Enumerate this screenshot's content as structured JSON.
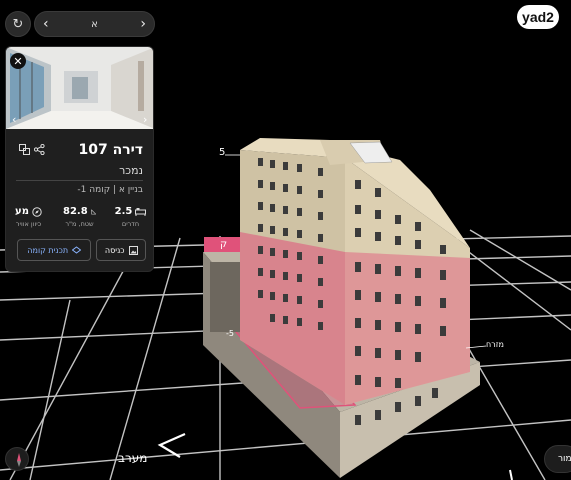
{
  "topbar": {
    "building_label": "א"
  },
  "logo": {
    "text": "yad2"
  },
  "card": {
    "title": "דירה 107",
    "status": "נמכר",
    "location": "בניין א  |  קומה 1-",
    "specs": [
      {
        "value": "2.5",
        "label": "חדרים",
        "icon": "bed-icon"
      },
      {
        "value": "82.8",
        "label": "שטח, מ\"ר",
        "icon": "area-icon"
      },
      {
        "value": "מע",
        "label": "כיוון אוויר",
        "icon": "compass-icon"
      }
    ],
    "floorplan_button": "תכנית קומה",
    "entrance_button": "כניסה"
  },
  "scene": {
    "floor_label": "5",
    "neg_label": "-5",
    "tag_label": "ק",
    "east_label": "מזרח",
    "west_label": "מערב"
  },
  "bottom": {
    "save_label": "שמור"
  },
  "colors": {
    "highlight": "#e0527a",
    "background": "#000000",
    "stone": "#d8c8aa"
  }
}
